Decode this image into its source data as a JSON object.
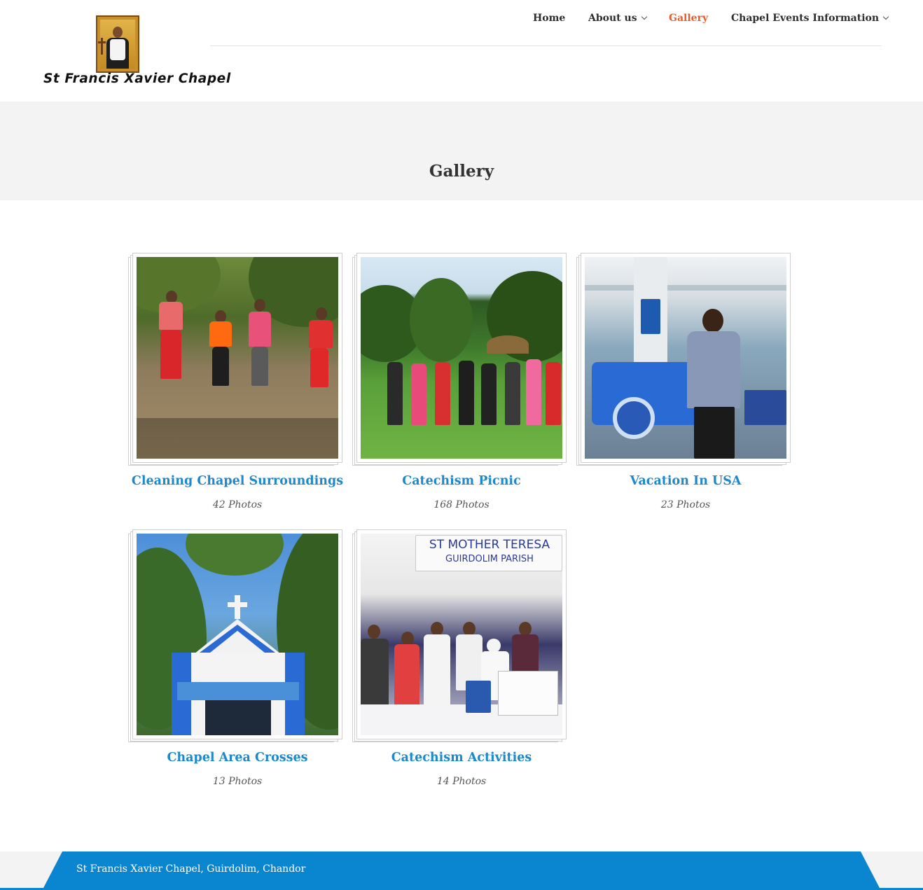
{
  "site": {
    "logo_text": "St Francis Xavier Chapel",
    "logo_icon": "saint-icon"
  },
  "nav": {
    "items": [
      {
        "label": "Home",
        "has_dropdown": false,
        "active": false
      },
      {
        "label": "About us",
        "has_dropdown": true,
        "active": false
      },
      {
        "label": "Gallery",
        "has_dropdown": false,
        "active": true
      },
      {
        "label": "Chapel Events Information",
        "has_dropdown": true,
        "active": false
      }
    ]
  },
  "page": {
    "title": "Gallery"
  },
  "albums": [
    {
      "title": "Cleaning Chapel Surroundings",
      "count": "42 Photos"
    },
    {
      "title": "Catechism Picnic",
      "count": "168 Photos"
    },
    {
      "title": "Vacation In USA",
      "count": "23 Photos"
    },
    {
      "title": "Chapel Area Crosses",
      "count": "13 Photos"
    },
    {
      "title": "Catechism Activities",
      "count": "14 Photos"
    }
  ],
  "photo_text": {
    "banner_line1": "ST MOTHER TERESA",
    "banner_line2": "GUIRDOLIM PARISH"
  },
  "footer": {
    "text": "St Francis Xavier Chapel, Guirdolim, Chandor"
  },
  "colors": {
    "accent": "#e85b2a",
    "link": "#1e88cc",
    "footer": "#0a86d0"
  }
}
